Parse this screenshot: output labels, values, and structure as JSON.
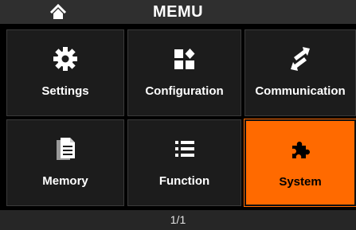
{
  "header": {
    "title": "MEMU",
    "home_icon": "home-icon"
  },
  "tiles": [
    {
      "label": "Settings",
      "icon": "gear-icon"
    },
    {
      "label": "Configuration",
      "icon": "configuration-icon"
    },
    {
      "label": "Communication",
      "icon": "communication-arrows-icon"
    },
    {
      "label": "Memory",
      "icon": "memory-document-icon"
    },
    {
      "label": "Function",
      "icon": "list-icon"
    },
    {
      "label": "System",
      "icon": "puzzle-icon",
      "selected": true
    }
  ],
  "footer": {
    "page_indicator": "1/1"
  },
  "colors": {
    "accent": "#ff6a00",
    "tile_bg": "#1c1c1c",
    "header_bg": "#2f2f2f"
  }
}
